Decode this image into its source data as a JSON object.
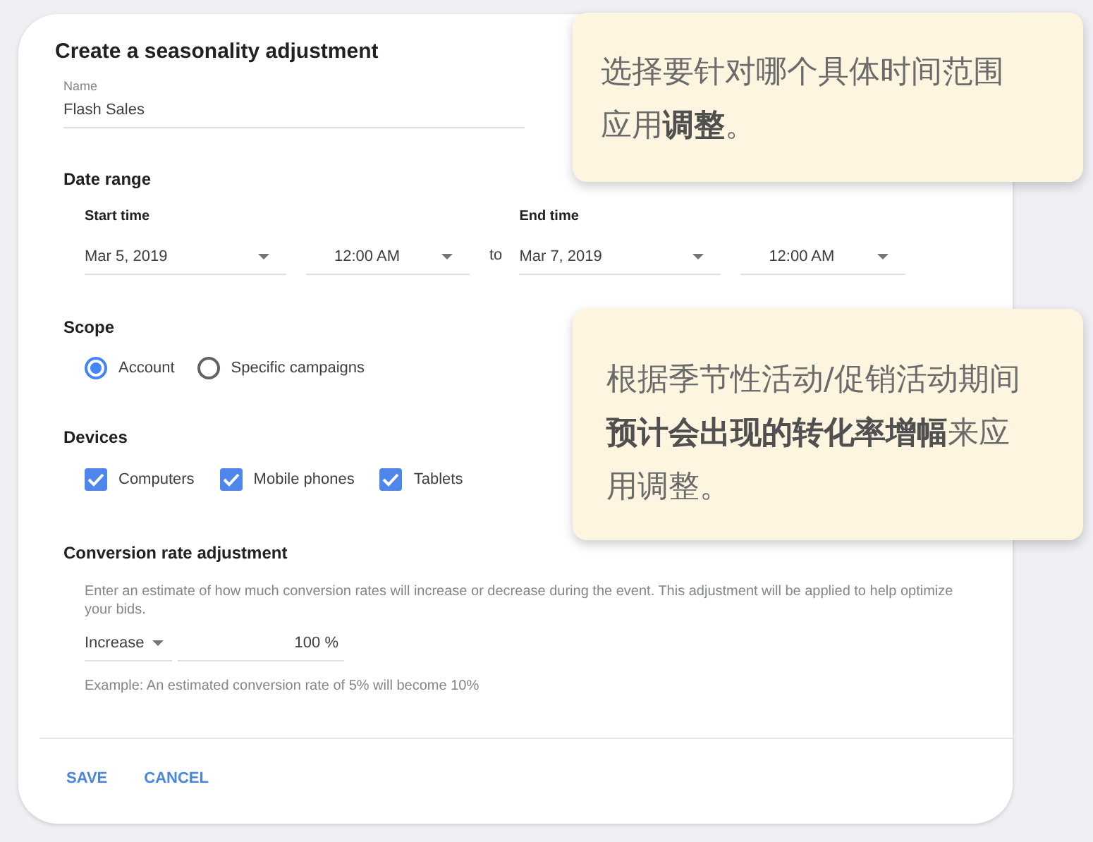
{
  "dialog": {
    "title": "Create a seasonality adjustment",
    "name_field": {
      "label": "Name",
      "value": "Flash Sales"
    },
    "date_range": {
      "heading": "Date range",
      "separator": "to",
      "start": {
        "label": "Start time",
        "date": "Mar 5, 2019",
        "time": "12:00 AM"
      },
      "end": {
        "label": "End time",
        "date": "Mar 7, 2019",
        "time": "12:00 AM"
      }
    },
    "scope": {
      "heading": "Scope",
      "options": [
        {
          "label": "Account",
          "selected": true
        },
        {
          "label": "Specific campaigns",
          "selected": false
        }
      ]
    },
    "devices": {
      "heading": "Devices",
      "options": [
        {
          "label": "Computers",
          "checked": true
        },
        {
          "label": "Mobile phones",
          "checked": true
        },
        {
          "label": "Tablets",
          "checked": true
        }
      ]
    },
    "conversion": {
      "heading": "Conversion rate adjustment",
      "description": "Enter an estimate of how much conversion rates will increase or decrease during the event. This adjustment will be applied to help optimize your bids.",
      "direction": "Increase",
      "amount": "100 %",
      "example": "Example: An estimated conversion rate of 5% will become 10%"
    },
    "buttons": [
      "SAVE",
      "CANCEL"
    ]
  },
  "callouts": [
    {
      "text": "选择要针对哪个具体时间范围应用**调整**。"
    },
    {
      "text": "根据季节性活动/促销活动期间**预计会出现的转化率增幅**来应用调整。"
    }
  ]
}
